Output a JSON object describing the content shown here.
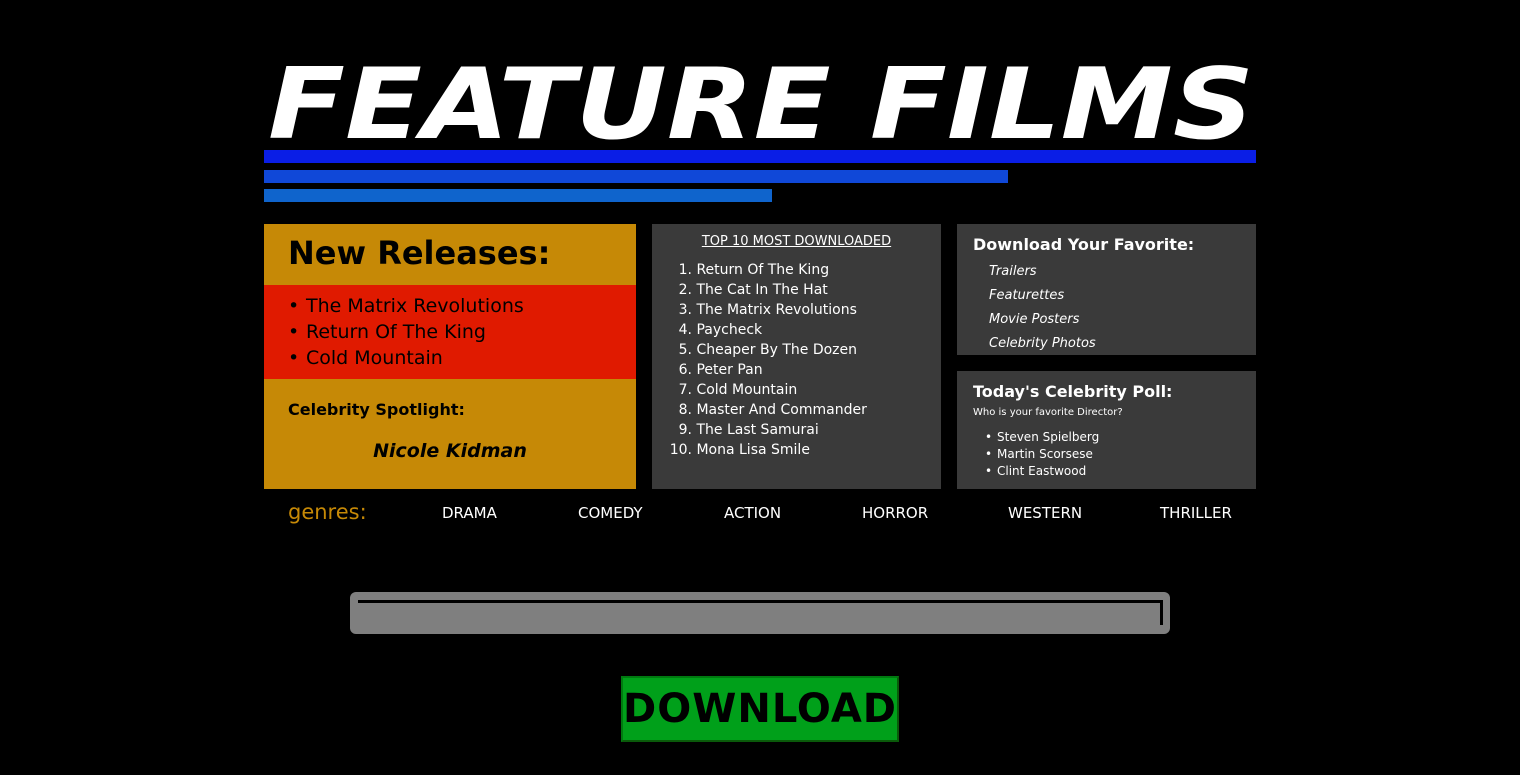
{
  "header": {
    "logo_text": "FEATURE FILMS"
  },
  "colors": {
    "gold": "#c68906",
    "red": "#e01a00",
    "panel": "#3a3a3a",
    "blue1": "#0a1ee6",
    "blue2": "#1048d8",
    "blue3": "#0f64cc",
    "download_green": "#00a01a"
  },
  "new_releases": {
    "title": "New Releases:",
    "items": [
      "The Matrix Revolutions",
      "Return Of The King",
      "Cold Mountain"
    ]
  },
  "spotlight": {
    "label": "Celebrity Spotlight:",
    "name": "Nicole Kidman"
  },
  "top10": {
    "title": "TOP 10 MOST DOWNLOADED",
    "items": [
      "Return Of The King",
      "The Cat In The Hat",
      "The Matrix Revolutions",
      "Paycheck",
      "Cheaper By The Dozen",
      "Peter Pan",
      "Cold Mountain",
      "Master And Commander",
      "The Last Samurai",
      "Mona Lisa Smile"
    ]
  },
  "download_favorite": {
    "title": "Download Your Favorite:",
    "items": [
      "Trailers",
      "Featurettes",
      "Movie Posters",
      "Celebrity Photos"
    ]
  },
  "poll": {
    "title": "Today's Celebrity Poll:",
    "question": "Who is your favorite Director?",
    "options": [
      "Steven Spielberg",
      "Martin Scorsese",
      "Clint Eastwood"
    ]
  },
  "genres": {
    "label": "genres:",
    "items": [
      "DRAMA",
      "COMEDY",
      "ACTION",
      "HORROR",
      "WESTERN",
      "THRILLER"
    ]
  },
  "search": {
    "value": "",
    "placeholder": ""
  },
  "download_button": {
    "label": "DOWNLOAD"
  }
}
